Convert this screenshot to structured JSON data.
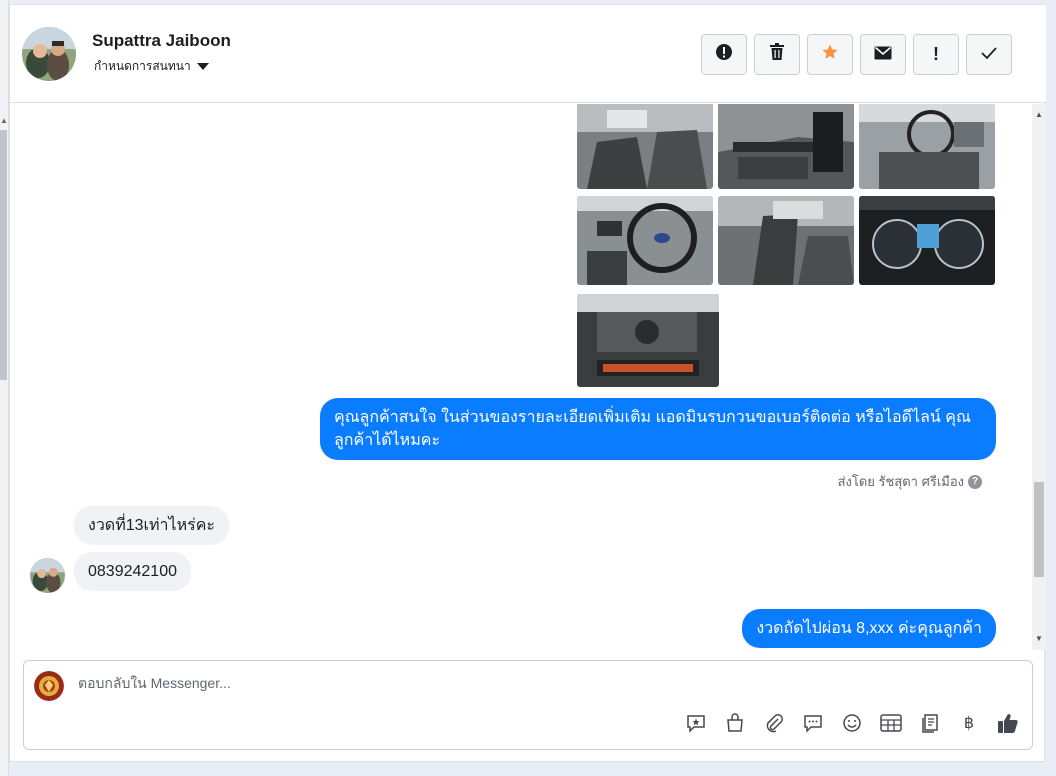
{
  "header": {
    "name": "Supattra Jaiboon",
    "assign_label": "กำหนดการสนทนา",
    "actions": [
      "mark-spam",
      "delete",
      "star",
      "mark-unread",
      "flag",
      "done"
    ],
    "action_glyphs": {
      "flag": "!",
      "done": "✓"
    }
  },
  "thread": {
    "messages": [
      {
        "side": "out",
        "text": "คุณลูกค้าสนใจ ในส่วนของรายละเอียดเพิ่มเติม แอดมินรบกวนขอเบอร์ติดต่อ หรือไอดีไลน์ คุณลูกค้าได้ไหมคะ"
      },
      {
        "side": "in",
        "text": "งวดที่13เท่าไหร่คะ"
      },
      {
        "side": "in",
        "text": "0839242100"
      },
      {
        "side": "out",
        "text": "งวดถัดไปผ่อน 8,xxx ค่ะคุณลูกค้า"
      }
    ],
    "sent_by": "ส่งโดย รัชสุดา ศรีเมือง",
    "sent_by_help": "?"
  },
  "composer": {
    "placeholder": "ตอบกลับใน Messenger...",
    "baht_symbol": "฿",
    "tools": [
      "saved-reply-icon",
      "shop-icon",
      "attach-icon",
      "message-template-icon",
      "emoji-icon",
      "appointment-icon",
      "form-icon",
      "baht-icon",
      "like-icon"
    ]
  },
  "colors": {
    "accent": "#0a7cff",
    "star": "#f5923e",
    "incoming_bubble": "#f0f2f5"
  }
}
